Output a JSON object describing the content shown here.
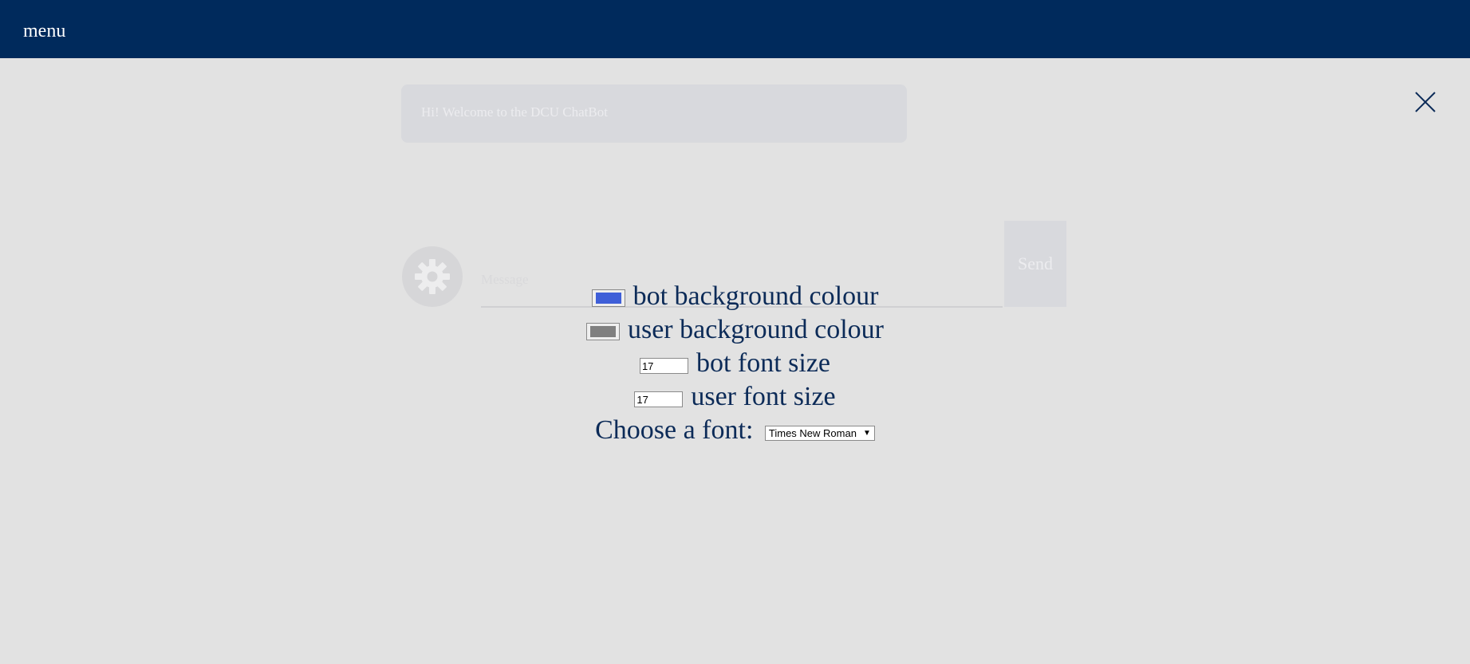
{
  "header": {
    "menu_label": "menu"
  },
  "chat": {
    "welcome_message": "Hi! Welcome to the DCU ChatBot",
    "message_placeholder": "Message",
    "send_label": "Send"
  },
  "settings": {
    "bot_bg_label": "bot background colour",
    "bot_bg_color": "#3f5fd8",
    "user_bg_label": "user background colour",
    "user_bg_color": "#808080",
    "bot_font_label": "bot font size",
    "bot_font_value": "17",
    "user_font_label": "user font size",
    "user_font_value": "17",
    "font_label": "Choose a font:",
    "font_selected": "Times New Roman"
  },
  "colors": {
    "header_bg": "#002a5c",
    "page_bg": "#e2e2e2",
    "text_primary": "#0c2b58"
  }
}
